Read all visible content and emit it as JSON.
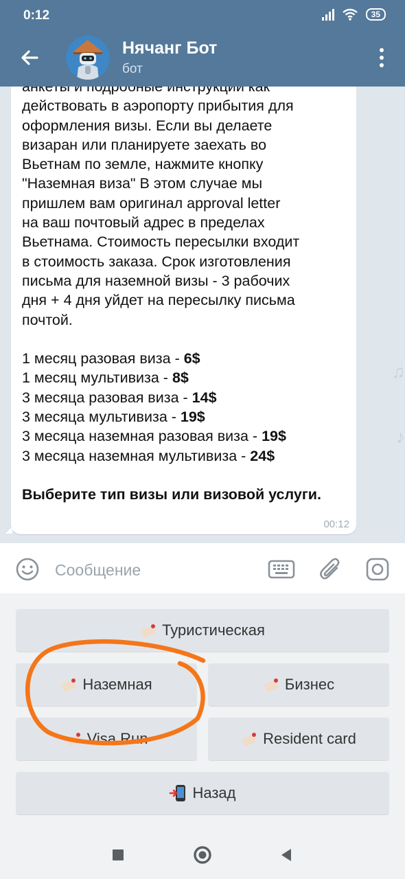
{
  "status_bar": {
    "time": "0:12",
    "battery": "35"
  },
  "header": {
    "title": "Нячанг Бот",
    "subtitle": "бот"
  },
  "message": {
    "lines": [
      [
        {
          "t": "анкеты и подробные инструкции как",
          "b": false
        }
      ],
      [
        {
          "t": "действовать в аэропорту прибытия для",
          "b": false
        }
      ],
      [
        {
          "t": "оформления визы. Если вы делаете",
          "b": false
        }
      ],
      [
        {
          "t": "визаран или планируете заехать во",
          "b": false
        }
      ],
      [
        {
          "t": "Вьетнам по земле, нажмите кнопку",
          "b": false
        }
      ],
      [
        {
          "t": "\"Наземная виза\" В этом случае мы",
          "b": false
        }
      ],
      [
        {
          "t": "пришлем вам оригинал approval letter",
          "b": false
        }
      ],
      [
        {
          "t": "на ваш почтовый адрес в пределах",
          "b": false
        }
      ],
      [
        {
          "t": "Вьетнама. Стоимость пересылки входит",
          "b": false
        }
      ],
      [
        {
          "t": "в стоимость заказа. Срок изготовления",
          "b": false
        }
      ],
      [
        {
          "t": "письма для наземной визы - 3 рабочих",
          "b": false
        }
      ],
      [
        {
          "t": "дня + 4 дня уйдет на пересылку письма",
          "b": false
        }
      ],
      [
        {
          "t": "почтой.",
          "b": false
        }
      ],
      [],
      [
        {
          "t": "1 месяц разовая виза - ",
          "b": false
        },
        {
          "t": "6$",
          "b": true
        }
      ],
      [
        {
          "t": "1 месяц мультивиза - ",
          "b": false
        },
        {
          "t": "8$",
          "b": true
        }
      ],
      [
        {
          "t": "3 месяца разовая виза - ",
          "b": false
        },
        {
          "t": "14$",
          "b": true
        }
      ],
      [
        {
          "t": "3 месяца мультивиза - ",
          "b": false
        },
        {
          "t": "19$",
          "b": true
        }
      ],
      [
        {
          "t": "3 месяца наземная разовая виза - ",
          "b": false
        },
        {
          "t": "19$",
          "b": true
        }
      ],
      [
        {
          "t": "3 месяца наземная мультивиза - ",
          "b": false
        },
        {
          "t": "24$",
          "b": true
        }
      ],
      [],
      [
        {
          "t": "Выберите тип визы или визовой услуги.",
          "b": true
        }
      ]
    ],
    "time": "00:12"
  },
  "composer": {
    "placeholder": "Сообщение"
  },
  "keyboard": {
    "tourist": "Туристическая",
    "ground": "Наземная",
    "business": "Бизнес",
    "visa_run": "Visa Run",
    "resident": "Resident card",
    "back": "Назад"
  },
  "colors": {
    "header": "#54799a",
    "annotation": "#f4761a"
  }
}
